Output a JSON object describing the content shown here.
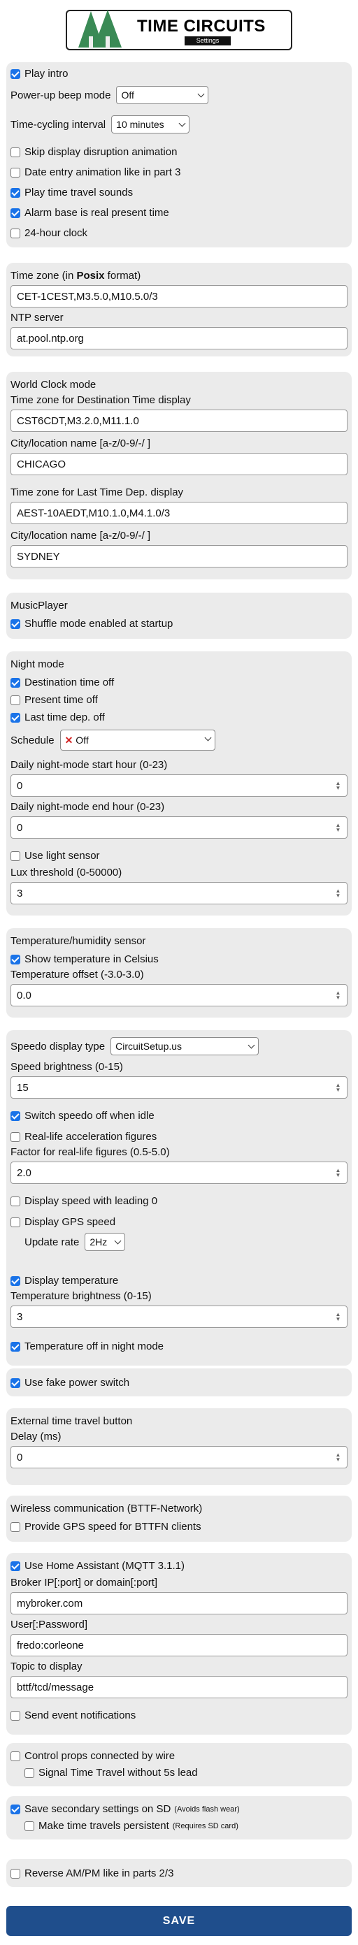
{
  "header": {
    "title": "TIME CIRCUITS",
    "subtitle": "Settings"
  },
  "general": {
    "play_intro": "Play intro",
    "beep_label": "Power-up beep mode",
    "beep_value": "Off",
    "cycle_label": "Time-cycling interval",
    "cycle_value": "10 minutes",
    "skip_disruption": "Skip display disruption animation",
    "date_entry_anim": "Date entry animation like in part 3",
    "tt_sounds": "Play time travel sounds",
    "alarm_base": "Alarm base is real present time",
    "clock24": "24-hour clock"
  },
  "tz": {
    "label_prefix": "Time zone (in ",
    "label_bold": "Posix",
    "label_suffix": " format)",
    "value": "CET-1CEST,M3.5.0,M10.5.0/3",
    "ntp_label": "NTP server",
    "ntp_value": "at.pool.ntp.org"
  },
  "worldclock": {
    "title": "World Clock mode",
    "dest_tz_label": "Time zone for Destination Time display",
    "dest_tz_value": "CST6CDT,M3.2.0,M11.1.0",
    "dest_city_label": "City/location name [a-z/0-9/-/ ]",
    "dest_city_value": "CHICAGO",
    "last_tz_label": "Time zone for Last Time Dep. display",
    "last_tz_value": "AEST-10AEDT,M10.1.0,M4.1.0/3",
    "last_city_label": "City/location name [a-z/0-9/-/ ]",
    "last_city_value": "SYDNEY"
  },
  "music": {
    "title": "MusicPlayer",
    "shuffle": "Shuffle mode enabled at startup"
  },
  "night": {
    "title": "Night mode",
    "dest_off": "Destination time off",
    "pres_off": "Present time off",
    "last_off": "Last time dep. off",
    "schedule_label": "Schedule",
    "schedule_value": "Off",
    "start_label": "Daily night-mode start hour (0-23)",
    "start_value": "0",
    "end_label": "Daily night-mode end hour (0-23)",
    "end_value": "0",
    "light_sensor": "Use light sensor",
    "lux_label": "Lux threshold (0-50000)",
    "lux_value": "3"
  },
  "temp": {
    "title": "Temperature/humidity sensor",
    "celsius": "Show temperature in Celsius",
    "offset_label": "Temperature offset (-3.0-3.0)",
    "offset_value": "0.0"
  },
  "speedo": {
    "type_label": "Speedo display type",
    "type_value": "CircuitSetup.us",
    "bright_label": "Speed brightness (0-15)",
    "bright_value": "15",
    "idle_off": "Switch speedo off when idle",
    "real_accel": "Real-life acceleration figures",
    "factor_label": "Factor for real-life figures (0.5-5.0)",
    "factor_value": "2.0",
    "leading0": "Display speed with leading 0",
    "gps_speed": "Display GPS speed",
    "rate_label": "Update rate",
    "rate_value": "2Hz",
    "disp_temp": "Display temperature",
    "temp_bright_label": "Temperature brightness (0-15)",
    "temp_bright_value": "3",
    "temp_night_off": "Temperature off in night mode"
  },
  "fakepower": {
    "label": "Use fake power switch"
  },
  "ettb": {
    "title": "External time travel button",
    "delay_label": "Delay (ms)",
    "delay_value": "0"
  },
  "bttfn": {
    "title": "Wireless communication (BTTF-Network)",
    "gps_clients": "Provide GPS speed for BTTFN clients"
  },
  "mqtt": {
    "use_ha": "Use Home Assistant (MQTT 3.1.1)",
    "broker_label": "Broker IP[:port] or domain[:port]",
    "broker_value": "mybroker.com",
    "user_label": "User[:Password]",
    "user_value": "fredo:corleone",
    "topic_label": "Topic to display",
    "topic_value": "bttf/tcd/message",
    "notify": "Send event notifications"
  },
  "wire": {
    "control_props": "Control props connected by wire",
    "signal_tt": "Signal Time Travel without 5s lead"
  },
  "sd": {
    "save_secondary": "Save secondary settings on SD",
    "save_secondary_note": "(Avoids flash wear)",
    "persistent": "Make time travels persistent",
    "persistent_note": "(Requires SD card)"
  },
  "ampm": {
    "label": "Reverse AM/PM like in parts 2/3"
  },
  "save_label": "SAVE"
}
